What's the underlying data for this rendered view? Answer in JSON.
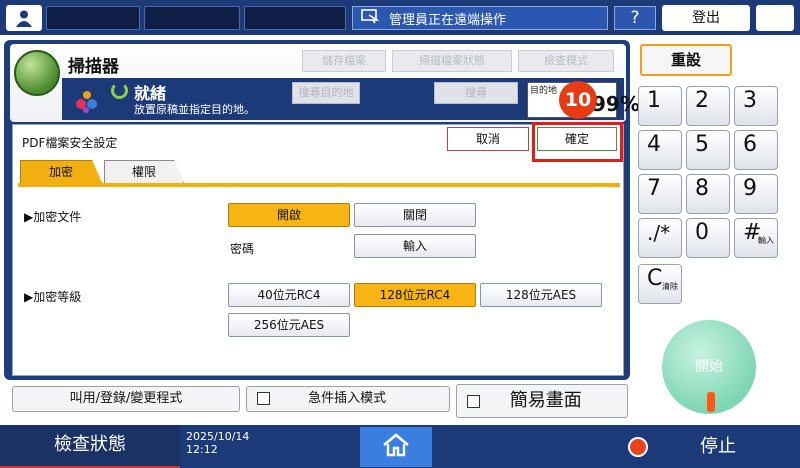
{
  "topbar": {
    "remote_text": "管理員正在遠端操作",
    "help_label": "?",
    "logout_label": "登出"
  },
  "app": {
    "title": "掃描器",
    "header_buttons": [
      "儲存檔案",
      "掃描檔案狀態",
      "檢查模式"
    ],
    "dest_button": "搜尋目的地",
    "search_button": "搜尋",
    "status_ready": "就緒",
    "status_sub": "放置原稿並指定目的地。",
    "counter_label": "目的地",
    "counter_value": "99%",
    "step_badge": "10"
  },
  "dialog": {
    "title": "PDF檔案安全設定",
    "cancel_label": "取消",
    "ok_label": "確定",
    "tabs": [
      "加密",
      "權限"
    ],
    "encrypt_doc_label": "▶加密文件",
    "on_label": "開啟",
    "off_label": "關閉",
    "password_label": "密碼",
    "input_label": "輸入",
    "level_label": "▶加密等級",
    "levels": [
      "40位元RC4",
      "128位元RC4",
      "128位元AES",
      "256位元AES"
    ],
    "selected_level": "128位元RC4"
  },
  "bottom": {
    "recall_label": "叫用/登錄/變更程式",
    "interrupt_label": "急件插入模式",
    "simple_label": "簡易畫面"
  },
  "keypad": {
    "reset_label": "重設",
    "keys": [
      "1",
      "2",
      "3",
      "4",
      "5",
      "6",
      "7",
      "8",
      "9",
      "./*",
      "0",
      "#",
      "C"
    ],
    "hash_sub": "輸入",
    "clear_sub": "清除",
    "start_label": "開始"
  },
  "footer": {
    "check_status_label": "檢查狀態",
    "date": "2025/10/14",
    "time": "12:12",
    "stop_label": "停止"
  },
  "colors": {
    "navy": "#1c3a78",
    "selected": "#f7b412",
    "alert": "#e21b1b"
  }
}
